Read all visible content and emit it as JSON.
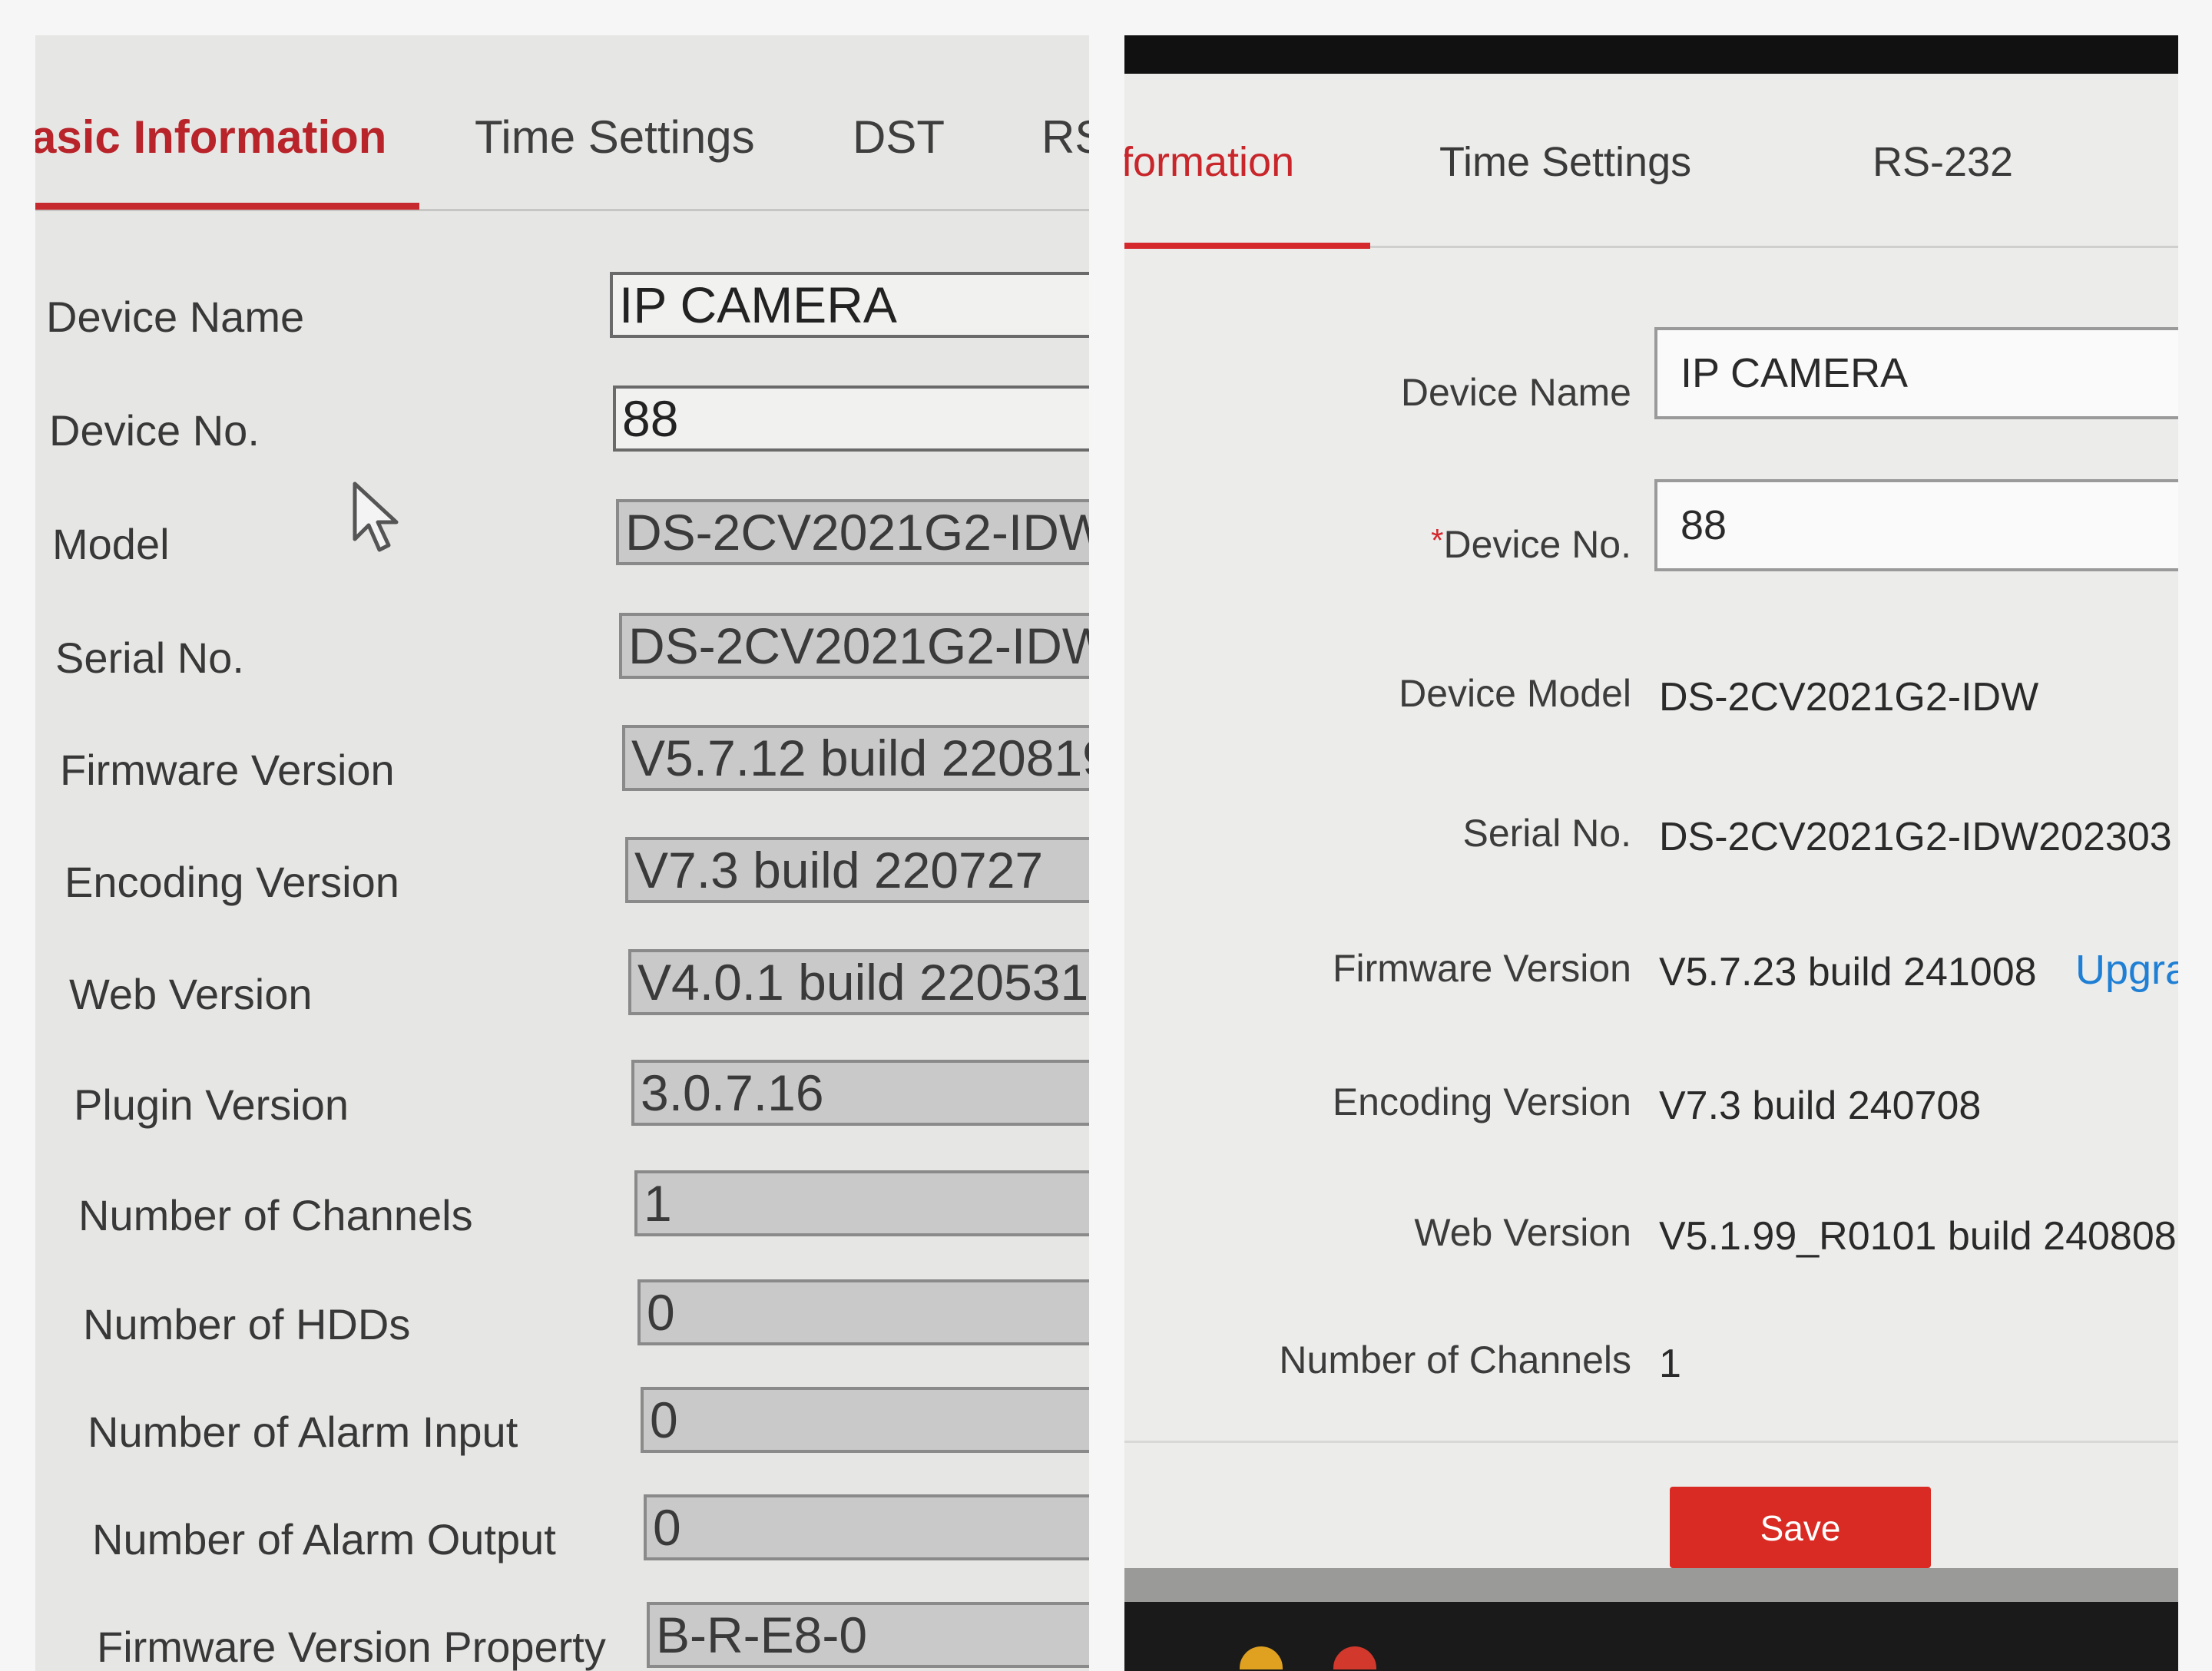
{
  "left": {
    "tabs": [
      "asic Information",
      "Time Settings",
      "DST",
      "RS"
    ],
    "rows": [
      {
        "label": "Device Name",
        "value": "IP CAMERA"
      },
      {
        "label": "Device No.",
        "value": "88"
      },
      {
        "label": "Model",
        "value": "DS-2CV2021G2-IDW"
      },
      {
        "label": "Serial No.",
        "value": "DS-2CV2021G2-IDW"
      },
      {
        "label": "Firmware Version",
        "value": "V5.7.12 build 220819"
      },
      {
        "label": "Encoding Version",
        "value": "V7.3 build 220727"
      },
      {
        "label": "Web Version",
        "value": "V4.0.1 build 220531"
      },
      {
        "label": "Plugin Version",
        "value": "3.0.7.16"
      },
      {
        "label": "Number of Channels",
        "value": "1"
      },
      {
        "label": "Number of HDDs",
        "value": "0"
      },
      {
        "label": "Number of Alarm Input",
        "value": "0"
      },
      {
        "label": "Number of Alarm Output",
        "value": "0"
      },
      {
        "label": "Firmware Version Property",
        "value": "B-R-E8-0"
      }
    ]
  },
  "right": {
    "tabs": [
      "formation",
      "Time Settings",
      "RS-232"
    ],
    "required_mark": "*",
    "rows": [
      {
        "label": "Device Name",
        "value": "IP CAMERA"
      },
      {
        "label": "Device No.",
        "value": "88"
      },
      {
        "label": "Device Model",
        "value": "DS-2CV2021G2-IDW"
      },
      {
        "label": "Serial No.",
        "value": "DS-2CV2021G2-IDW202303"
      },
      {
        "label": "Firmware Version",
        "value": "V5.7.23 build 241008"
      },
      {
        "label": "Encoding Version",
        "value": "V7.3 build 240708"
      },
      {
        "label": "Web Version",
        "value": "V5.1.99_R0101 build 240808"
      },
      {
        "label": "Number of Channels",
        "value": "1"
      }
    ],
    "upgrade_link": "Upgra",
    "save_label": "Save"
  },
  "colors": {
    "accent_red": "#c62a2e",
    "save_button": "#d92b23",
    "link_blue": "#1e7fd4"
  }
}
